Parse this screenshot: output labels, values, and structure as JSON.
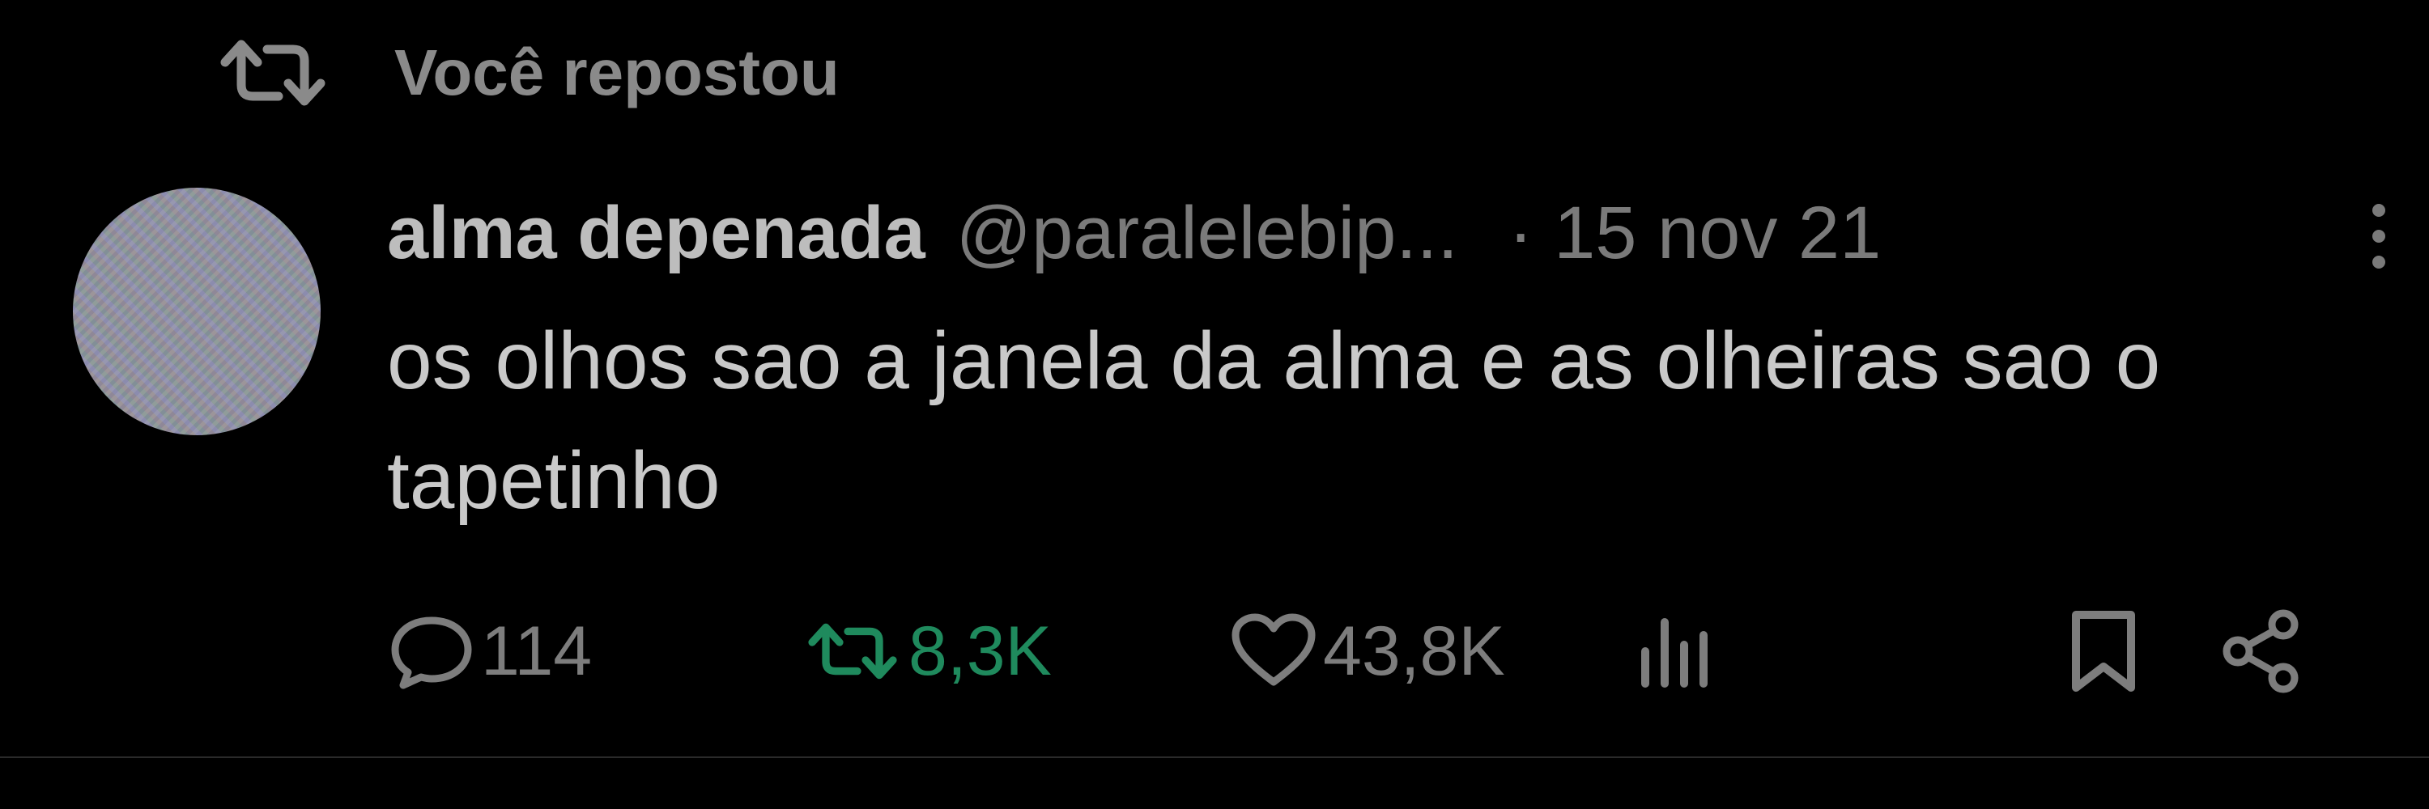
{
  "repost": {
    "icon": "repost-icon",
    "label": "Você repostou"
  },
  "tweet": {
    "display_name": "alma depenada",
    "handle": "@paralelebip...",
    "date": "· 15 nov 21",
    "text": "os olhos sao a janela da alma e as olheiras sao o tapetinho",
    "actions": {
      "replies": "114",
      "reposts": "8,3K",
      "likes": "43,8K"
    }
  },
  "colors": {
    "background": "#000000",
    "text_primary": "#c9c9c9",
    "text_secondary": "#7a7a7a",
    "repost_active": "#1f8a5d"
  }
}
